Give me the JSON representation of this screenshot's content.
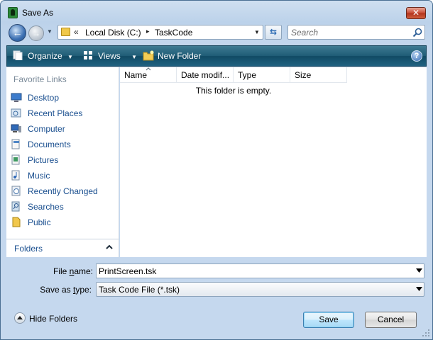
{
  "window": {
    "title": "Save As",
    "close_label": "✕"
  },
  "address": {
    "overflow": "«",
    "crumbs": [
      "Local Disk (C:)",
      "TaskCode"
    ],
    "separator": "▸"
  },
  "search": {
    "placeholder": "Search"
  },
  "toolbar": {
    "organize": "Organize",
    "views": "Views",
    "new_folder": "New Folder",
    "help": "?"
  },
  "nav": {
    "header": "Favorite Links",
    "items": [
      {
        "label": "Desktop",
        "icon": "desktop-icon"
      },
      {
        "label": "Recent Places",
        "icon": "recent-places-icon"
      },
      {
        "label": "Computer",
        "icon": "computer-icon"
      },
      {
        "label": "Documents",
        "icon": "documents-icon"
      },
      {
        "label": "Pictures",
        "icon": "pictures-icon"
      },
      {
        "label": "Music",
        "icon": "music-icon"
      },
      {
        "label": "Recently Changed",
        "icon": "recently-changed-icon"
      },
      {
        "label": "Searches",
        "icon": "searches-icon"
      },
      {
        "label": "Public",
        "icon": "public-icon"
      }
    ],
    "folders_label": "Folders"
  },
  "file_list": {
    "columns": [
      "Name",
      "Date modif...",
      "Type",
      "Size"
    ],
    "empty_message": "This folder is empty."
  },
  "form": {
    "file_name_label_pre": "File ",
    "file_name_label_ul": "n",
    "file_name_label_post": "ame:",
    "file_name_value": "PrintScreen.tsk",
    "save_type_label_pre": "Save as ",
    "save_type_label_ul": "t",
    "save_type_label_post": "ype:",
    "save_type_value": "Task Code File (*.tsk)"
  },
  "footer": {
    "hide_folders": "Hide Folders",
    "save": "Save",
    "cancel": "Cancel"
  },
  "colors": {
    "toolbar": "#1f5c76",
    "link_text": "#1a4f8f",
    "frame": "#c5d8ee"
  }
}
